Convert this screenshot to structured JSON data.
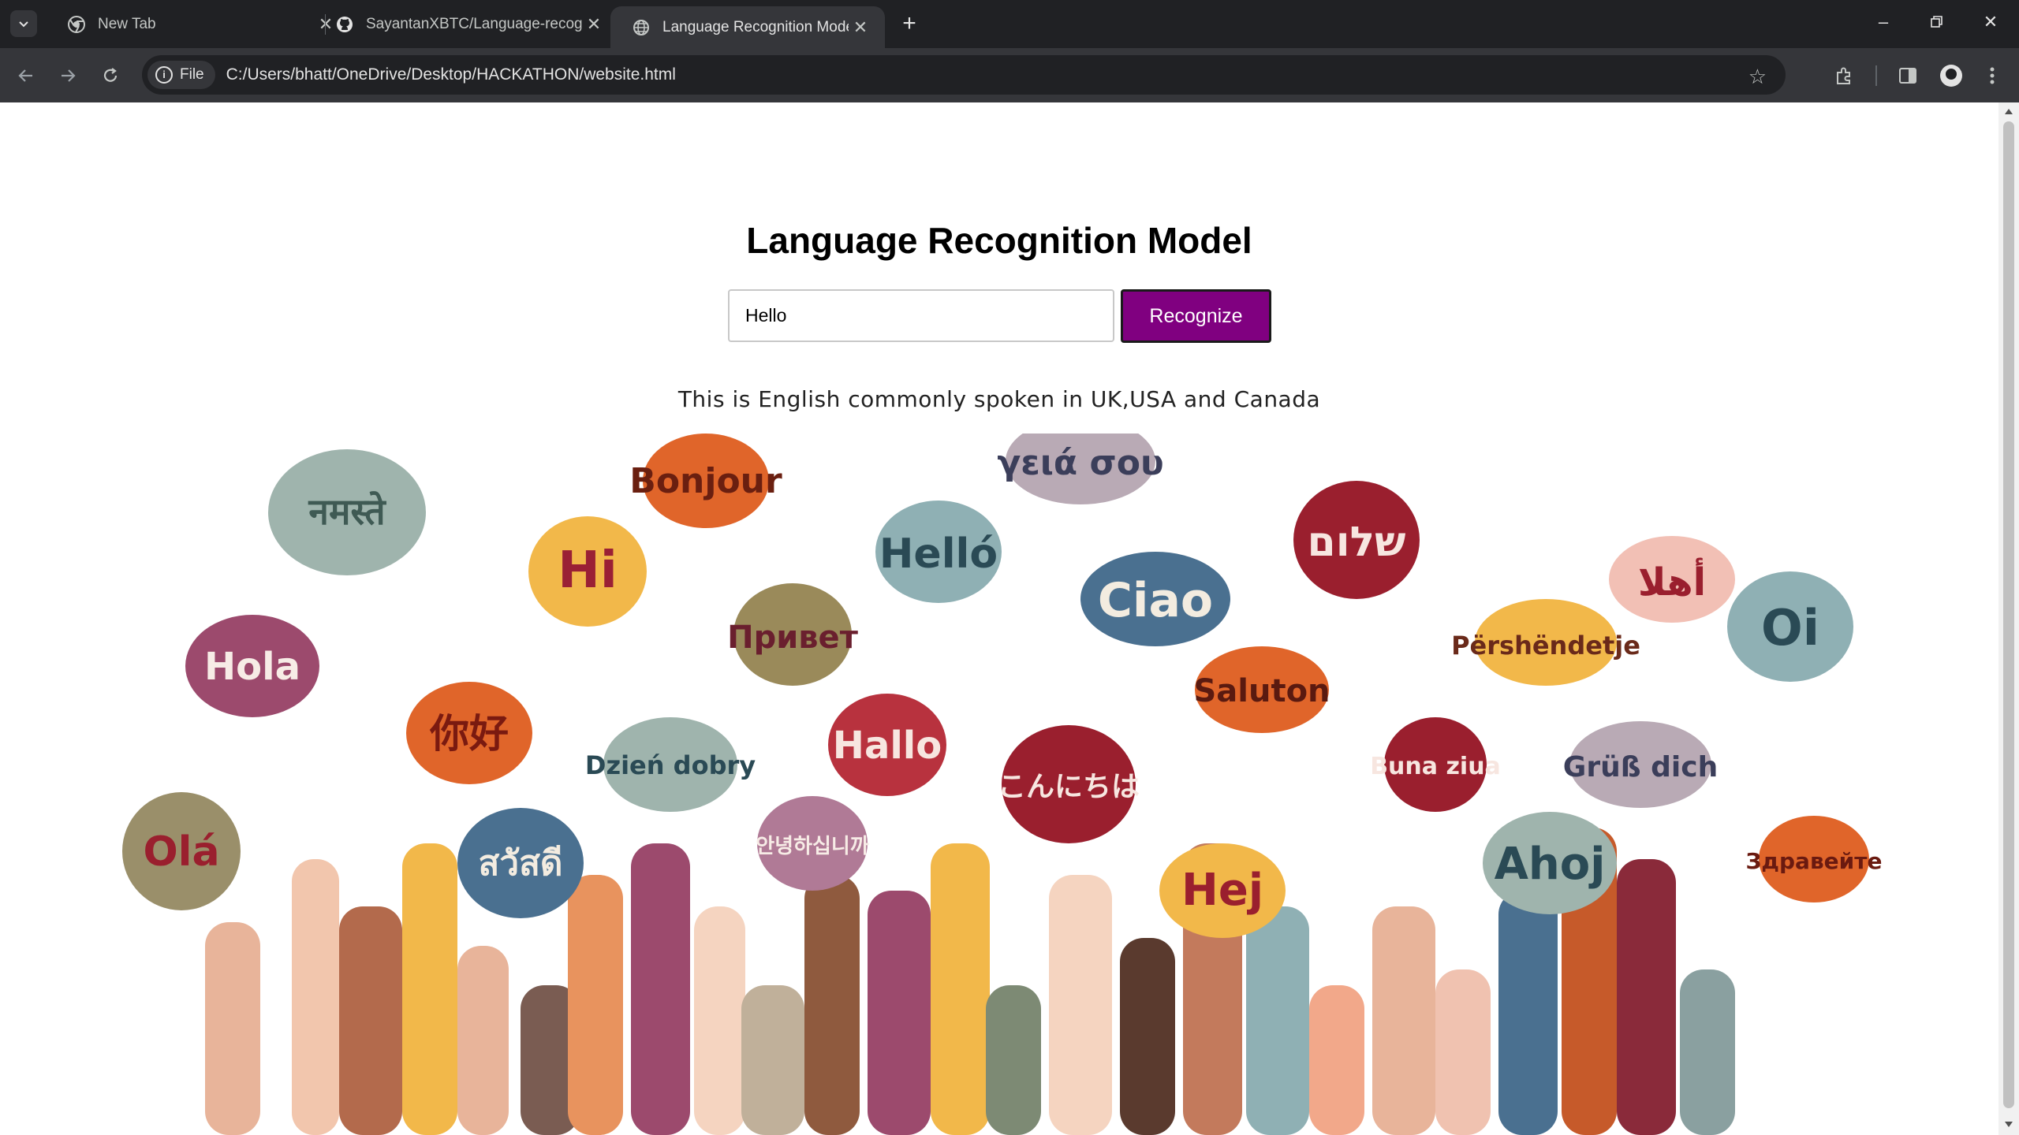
{
  "browser": {
    "tabs": [
      {
        "title": "New Tab",
        "active": false,
        "icon": "chrome-icon"
      },
      {
        "title": "SayantanXBTC/Language-recog",
        "active": false,
        "icon": "github-icon"
      },
      {
        "title": "Language Recognition Model",
        "active": true,
        "icon": "globe-icon"
      }
    ],
    "address_chip": "File",
    "url": "C:/Users/bhatt/OneDrive/Desktop/HACKATHON/website.html"
  },
  "page": {
    "title": "Language Recognition Model",
    "input_value": "Hello",
    "button_label": "Recognize",
    "result_text": "This is English commonly spoken in UK,USA and Canada",
    "accent_color": "#800080"
  },
  "banner": {
    "greetings": [
      "नमस्ते",
      "Bonjour",
      "γειά σου",
      "Hi",
      "Helló",
      "Ciao",
      "שלום",
      "Hola",
      "Привет",
      "Saluton",
      "Përshëndetje",
      "أهلا",
      "Oi",
      "你好",
      "Hallo",
      "Dzień dobry",
      "こんにちは",
      "Buna ziua",
      "Grüß dich",
      "Olá",
      "สวัสดี",
      "안녕하십니까",
      "Hej",
      "Ahoj",
      "Здравейте"
    ]
  }
}
